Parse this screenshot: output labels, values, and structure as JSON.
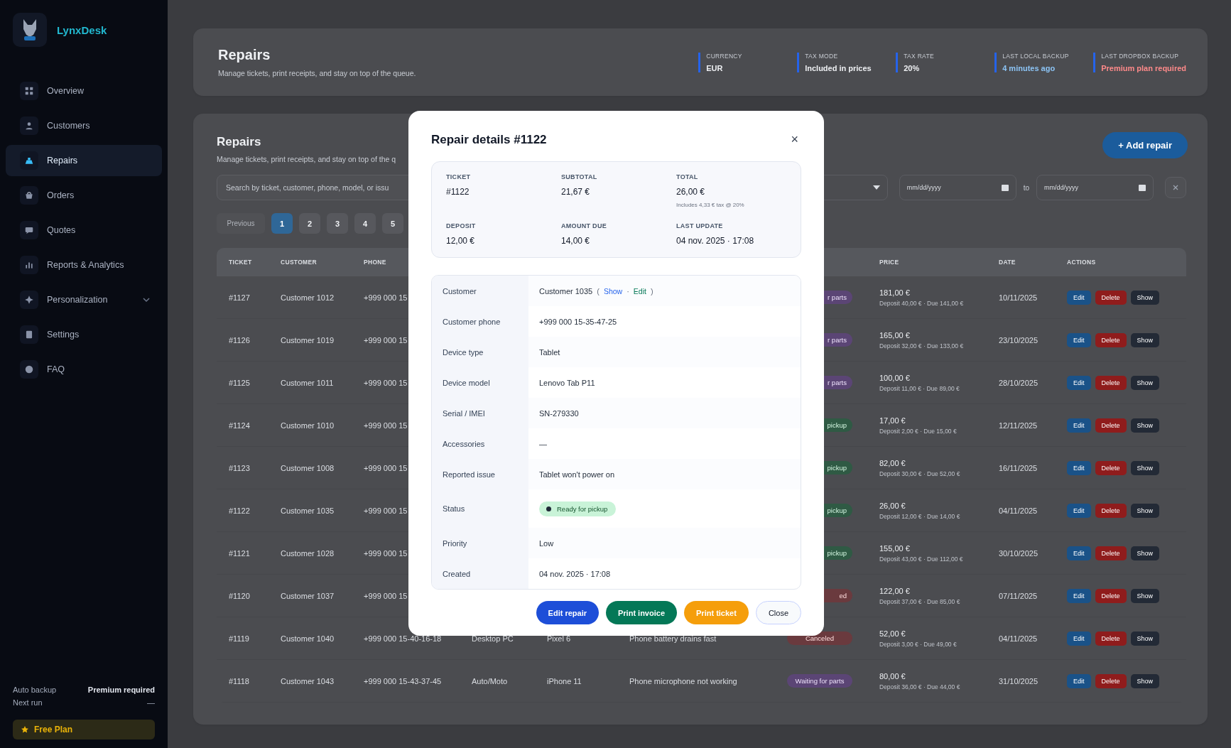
{
  "sidebar": {
    "brand": "LynxDesk",
    "items": [
      {
        "label": "Overview",
        "selected": false
      },
      {
        "label": "Customers",
        "selected": false
      },
      {
        "label": "Repairs",
        "selected": true
      },
      {
        "label": "Orders",
        "selected": false
      },
      {
        "label": "Quotes",
        "selected": false
      },
      {
        "label": "Reports & Analytics",
        "selected": false
      },
      {
        "label": "Personalization",
        "selected": false,
        "expanded": false
      },
      {
        "label": "Settings",
        "selected": false
      },
      {
        "label": "FAQ",
        "selected": false
      }
    ],
    "footer": {
      "auto_backup_label": "Auto backup",
      "auto_backup_value": "Premium required",
      "next_run_label": "Next run",
      "next_run_value": "—",
      "plan": "Free Plan"
    }
  },
  "header": {
    "title": "Repairs",
    "subtitle": "Manage tickets, print receipts, and stay on top of the queue.",
    "stats": [
      {
        "label": "CURRENCY",
        "value": "EUR",
        "kind": "plain"
      },
      {
        "label": "TAX MODE",
        "value": "Included in prices",
        "kind": "plain"
      },
      {
        "label": "TAX RATE",
        "value": "20%",
        "kind": "plain"
      },
      {
        "label": "LAST LOCAL BACKUP",
        "value": "4 minutes ago",
        "kind": "info"
      },
      {
        "label": "LAST DROPBOX BACKUP",
        "value": "Premium plan required",
        "kind": "error"
      }
    ]
  },
  "repairs": {
    "title": "Repairs",
    "subtitle": "Manage tickets, print receipts, and stay on top of the q",
    "add_button": "+ Add repair",
    "search": {
      "placeholder": "Search by ticket, customer, phone, model, or issu"
    },
    "date_from": {
      "placeholder": "mm/dd/yyyy"
    },
    "to_label": "to",
    "date_to": {
      "placeholder": "mm/dd/yyyy"
    },
    "pagination": {
      "previous": {
        "label": "Previous",
        "disabled": true
      },
      "pages": [
        {
          "label": "1",
          "selected": true
        },
        {
          "label": "2",
          "selected": false
        },
        {
          "label": "3",
          "selected": false
        },
        {
          "label": "4",
          "selected": false
        },
        {
          "label": "5",
          "selected": false
        }
      ]
    },
    "table": {
      "columns": [
        "TICKET",
        "CUSTOMER",
        "PHONE",
        "PRICE",
        "DATE",
        "ACTIONS"
      ],
      "rows": [
        {
          "ticket": "#1127",
          "customer": "Customer 1012",
          "phone": "+999 000 15",
          "status": {
            "label": "r parts",
            "kind": "waiting"
          },
          "price": "181,00 €",
          "price_detail": "Deposit 40,00 € · Due 141,00 €",
          "date": "10/11/2025",
          "actions": [
            "Edit",
            "Delete",
            "Show"
          ]
        },
        {
          "ticket": "#1126",
          "customer": "Customer 1019",
          "phone": "+999 000 15",
          "status": {
            "label": "r parts",
            "kind": "waiting"
          },
          "price": "165,00 €",
          "price_detail": "Deposit 32,00 € · Due 133,00 €",
          "date": "23/10/2025",
          "actions": [
            "Edit",
            "Delete",
            "Show"
          ]
        },
        {
          "ticket": "#1125",
          "customer": "Customer 1011",
          "phone": "+999 000 15",
          "status": {
            "label": "r parts",
            "kind": "waiting"
          },
          "price": "100,00 €",
          "price_detail": "Deposit 11,00 € · Due 89,00 €",
          "date": "28/10/2025",
          "actions": [
            "Edit",
            "Delete",
            "Show"
          ]
        },
        {
          "ticket": "#1124",
          "customer": "Customer 1010",
          "phone": "+999 000 15",
          "status": {
            "label": "pickup",
            "kind": "ready"
          },
          "price": "17,00 €",
          "price_detail": "Deposit 2,00 € · Due 15,00 €",
          "date": "12/11/2025",
          "actions": [
            "Edit",
            "Delete",
            "Show"
          ]
        },
        {
          "ticket": "#1123",
          "customer": "Customer 1008",
          "phone": "+999 000 15",
          "status": {
            "label": "pickup",
            "kind": "ready"
          },
          "price": "82,00 €",
          "price_detail": "Deposit 30,00 € · Due 52,00 €",
          "date": "16/11/2025",
          "actions": [
            "Edit",
            "Delete",
            "Show"
          ]
        },
        {
          "ticket": "#1122",
          "customer": "Customer 1035",
          "phone": "+999 000 15",
          "status": {
            "label": "pickup",
            "kind": "ready"
          },
          "price": "26,00 €",
          "price_detail": "Deposit 12,00 € · Due 14,00 €",
          "date": "04/11/2025",
          "actions": [
            "Edit",
            "Delete",
            "Show"
          ]
        },
        {
          "ticket": "#1121",
          "customer": "Customer 1028",
          "phone": "+999 000 15",
          "status": {
            "label": "pickup",
            "kind": "ready"
          },
          "price": "155,00 €",
          "price_detail": "Deposit 43,00 € · Due 112,00 €",
          "date": "30/10/2025",
          "actions": [
            "Edit",
            "Delete",
            "Show"
          ]
        },
        {
          "ticket": "#1120",
          "customer": "Customer 1037",
          "phone": "+999 000 15",
          "status": {
            "label": "ed",
            "kind": "canceled"
          },
          "price": "122,00 €",
          "price_detail": "Deposit 37,00 € · Due 85,00 €",
          "date": "07/11/2025",
          "actions": [
            "Edit",
            "Delete",
            "Show"
          ]
        },
        {
          "ticket": "#1119",
          "customer": "Customer 1040",
          "phone": "+999 000 15-40-16-18",
          "device": "Desktop PC",
          "model": "Pixel 6",
          "issue": "Phone battery drains fast",
          "status": {
            "label": "Canceled",
            "kind": "canceled"
          },
          "price": "52,00 €",
          "price_detail": "Deposit 3,00 € · Due 49,00 €",
          "date": "04/11/2025",
          "actions": [
            "Edit",
            "Delete",
            "Show"
          ]
        },
        {
          "ticket": "#1118",
          "customer": "Customer 1043",
          "phone": "+999 000 15-43-37-45",
          "device": "Auto/Moto",
          "model": "iPhone 11",
          "issue": "Phone microphone not working",
          "status": {
            "label": "Waiting for parts",
            "kind": "waiting"
          },
          "price": "80,00 €",
          "price_detail": "Deposit 36,00 € · Due 44,00 €",
          "date": "31/10/2025",
          "actions": [
            "Edit",
            "Delete",
            "Show"
          ]
        }
      ]
    }
  },
  "modal": {
    "title": "Repair details #1122",
    "close": "×",
    "summary": [
      {
        "label": "TICKET",
        "value": "#1122"
      },
      {
        "label": "SUBTOTAL",
        "value": "21,67 €"
      },
      {
        "label": "TOTAL",
        "value": "26,00 €",
        "note": "Includes 4,33 € tax @ 20%"
      },
      {
        "label": "DEPOSIT",
        "value": "12,00 €"
      },
      {
        "label": "AMOUNT DUE",
        "value": "14,00 €"
      },
      {
        "label": "LAST UPDATE",
        "value": "04 nov. 2025 · 17:08"
      }
    ],
    "details": [
      {
        "label": "Customer",
        "kind": "customer",
        "value": "Customer 1035",
        "open": "(",
        "links": [
          {
            "label": "Show",
            "kind": "show"
          },
          {
            "label": "Edit",
            "kind": "edit"
          }
        ],
        "separator": "·",
        "close": ")"
      },
      {
        "label": "Customer phone",
        "kind": "text",
        "value": "+999 000 15-35-47-25"
      },
      {
        "label": "Device type",
        "kind": "text",
        "value": "Tablet"
      },
      {
        "label": "Device model",
        "kind": "text",
        "value": "Lenovo Tab P11"
      },
      {
        "label": "Serial / IMEI",
        "kind": "text",
        "value": "SN-279330"
      },
      {
        "label": "Accessories",
        "kind": "text",
        "value": "—"
      },
      {
        "label": "Reported issue",
        "kind": "text",
        "value": "Tablet won't power on"
      },
      {
        "label": "Status",
        "kind": "status",
        "badge": {
          "label": "Ready for pickup",
          "kind": "ready"
        }
      },
      {
        "label": "Priority",
        "kind": "text",
        "value": "Low"
      },
      {
        "label": "Created",
        "kind": "text",
        "value": "04 nov. 2025 · 17:08"
      }
    ],
    "buttons": [
      {
        "label": "Edit repair",
        "kind": "primary"
      },
      {
        "label": "Print invoice",
        "kind": "success"
      },
      {
        "label": "Print ticket",
        "kind": "warning"
      },
      {
        "label": "Close",
        "kind": "secondary"
      }
    ]
  }
}
